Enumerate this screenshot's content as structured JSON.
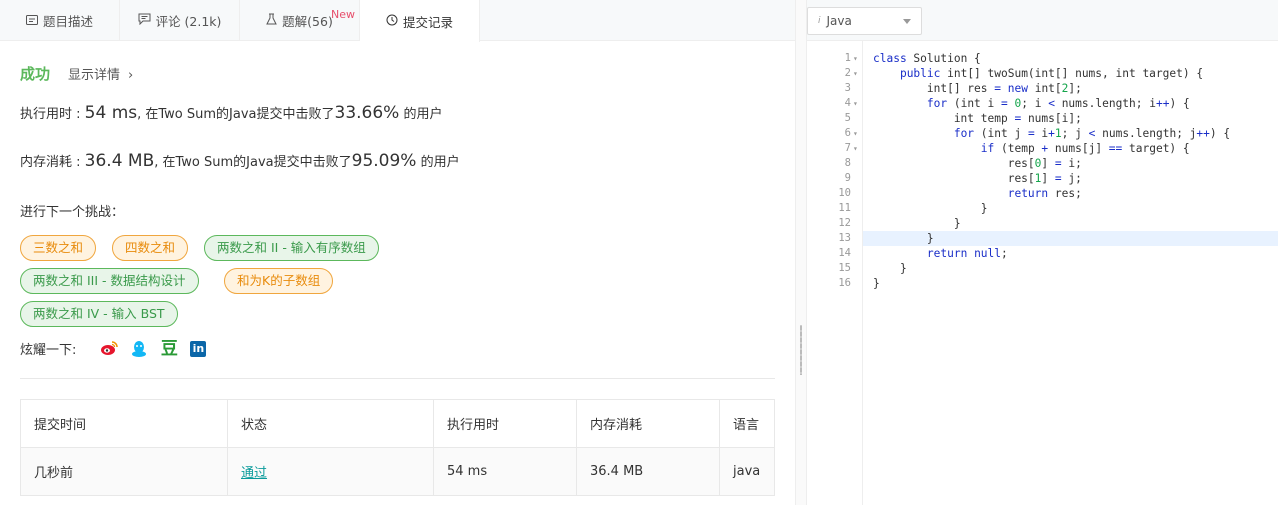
{
  "tabs": [
    {
      "label": "题目描述",
      "icon": "description-icon"
    },
    {
      "label": "评论 (2.1k)",
      "icon": "comment-icon"
    },
    {
      "label": "题解(56)",
      "icon": "flask-icon",
      "badge": "New"
    },
    {
      "label": "提交记录",
      "icon": "clock-icon",
      "active": true
    }
  ],
  "result": {
    "status": "成功",
    "details_label": "显示详情",
    "runtime_prefix": "执行用时 : ",
    "runtime_value": "54 ms",
    "runtime_mid": ", 在Two Sum的Java提交中击败了",
    "runtime_pct": "33.66%",
    "runtime_suffix": " 的用户",
    "memory_prefix": "内存消耗 : ",
    "memory_value": "36.4 MB",
    "memory_mid": ", 在Two Sum的Java提交中击败了",
    "memory_pct": "95.09%",
    "memory_suffix": " 的用户"
  },
  "challenge": {
    "title": "进行下一个挑战：",
    "tags": [
      {
        "label": "三数之和",
        "color": "orange"
      },
      {
        "label": "四数之和",
        "color": "orange"
      },
      {
        "label": "两数之和 II - 输入有序数组",
        "color": "green"
      },
      {
        "label": "两数之和 III - 数据结构设计",
        "color": "green"
      },
      {
        "label": "和为K的子数组",
        "color": "orange"
      },
      {
        "label": "两数之和 IV - 输入 BST",
        "color": "green"
      }
    ]
  },
  "share": {
    "label": "炫耀一下:",
    "icons": [
      "weibo-icon",
      "qq-icon",
      "douban-icon",
      "linkedin-icon"
    ],
    "douban_glyph": "豆",
    "linkedin_glyph": "in"
  },
  "submissions": {
    "headers": [
      "提交时间",
      "状态",
      "执行用时",
      "内存消耗",
      "语言"
    ],
    "rows": [
      {
        "time": "几秒前",
        "status": "通过",
        "runtime": "54 ms",
        "memory": "36.4 MB",
        "lang": "java"
      }
    ]
  },
  "editor": {
    "language": "Java",
    "lines": [
      "class Solution {",
      "    public int[] twoSum(int[] nums, int target) {",
      "        int[] res = new int[2];",
      "        for (int i = 0; i < nums.length; i++) {",
      "            int temp = nums[i];",
      "            for (int j = i+1; j < nums.length; j++) {",
      "                if (temp + nums[j] == target) {",
      "                    res[0] = i;",
      "                    res[1] = j;",
      "                    return res;",
      "                }",
      "            }",
      "        }",
      "        return null;",
      "    }",
      "}"
    ],
    "fold_lines": [
      1,
      2,
      4,
      6,
      7
    ],
    "highlight_line": 13
  },
  "colors": {
    "success": "#5cb85c",
    "orange_tag": "#f0a63e",
    "green_tag": "#5cb85c",
    "pass_link": "#0a9b9b",
    "new_badge": "#e64e6b"
  }
}
